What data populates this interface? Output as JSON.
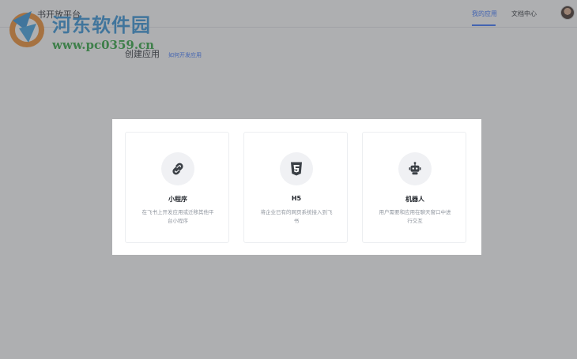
{
  "header": {
    "brand": "书开放平台",
    "nav": [
      {
        "label": "我的应用",
        "active": true
      },
      {
        "label": "文档中心",
        "active": false
      }
    ]
  },
  "watermark": {
    "title": "河东软件园",
    "url": "www.pc0359.cn"
  },
  "page": {
    "title": "创建应用",
    "help_link": "如何开发应用"
  },
  "modal": {
    "cards": [
      {
        "title": "小程序",
        "desc": "在飞书上开发应用或迁移其他平台小程序",
        "icon": "link-icon"
      },
      {
        "title": "H5",
        "desc": "将企业已有的网页系统接入到飞书",
        "icon": "html5-icon"
      },
      {
        "title": "机器人",
        "desc": "用户需要和应用在聊天窗口中进行交互",
        "icon": "robot-icon"
      }
    ]
  },
  "colors": {
    "accent": "#3370ff",
    "icon_dark": "#3b4046",
    "mask": "rgba(85,88,92,0.48)"
  }
}
